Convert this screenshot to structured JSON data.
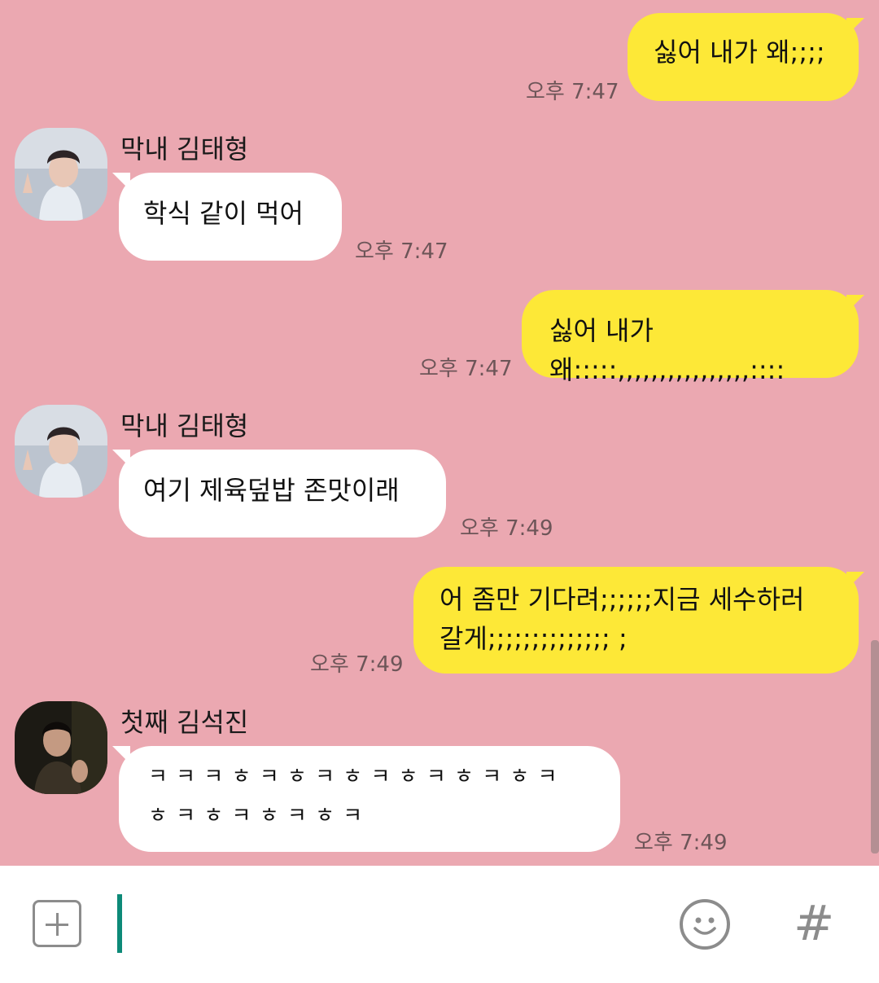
{
  "messages": [
    {
      "side": "me",
      "text": "싫어 내가 왜;;;;",
      "time": "오후 7:47"
    },
    {
      "side": "them",
      "sender": "막내 김태형",
      "avatar": "v-avatar",
      "text": "학식 같이 먹어",
      "time": "오후 7:47"
    },
    {
      "side": "me",
      "text": "싫어 내가 왜:::::,,,,,,,,,,,,,,,,::::",
      "time": "오후 7:47"
    },
    {
      "side": "them",
      "sender": "막내 김태형",
      "avatar": "v-avatar",
      "text": "여기 제육덮밥 존맛이래",
      "time": "오후 7:49"
    },
    {
      "side": "me",
      "text_line1": "어 좀만 기다려;;;;;;지금 세수하러",
      "text_line2": "갈게;;;;;;;;;;;;;; ;",
      "time": "오후 7:49"
    },
    {
      "side": "them",
      "sender": "첫째 김석진",
      "avatar": "jin-avatar",
      "text_line1": "ㅋ ㅋ ㅋ ㅎ ㅋ ㅎ ㅋ ㅎ ㅋ ㅎ ㅋ ㅎ ㅋ ㅎ ㅋ",
      "text_line2": "ㅎ ㅋ ㅎ ㅋ ㅎ ㅋ ㅎ ㅋ",
      "time": "오후 7:49"
    }
  ],
  "input_bar": {
    "attach_icon": "plus-square-icon",
    "emoji_icon": "smiley-icon",
    "hash_label": "#"
  },
  "colors": {
    "chat_background": "#eba8b1",
    "my_bubble": "#fde837",
    "their_bubble": "#ffffff",
    "cursor": "#0d8a78"
  }
}
